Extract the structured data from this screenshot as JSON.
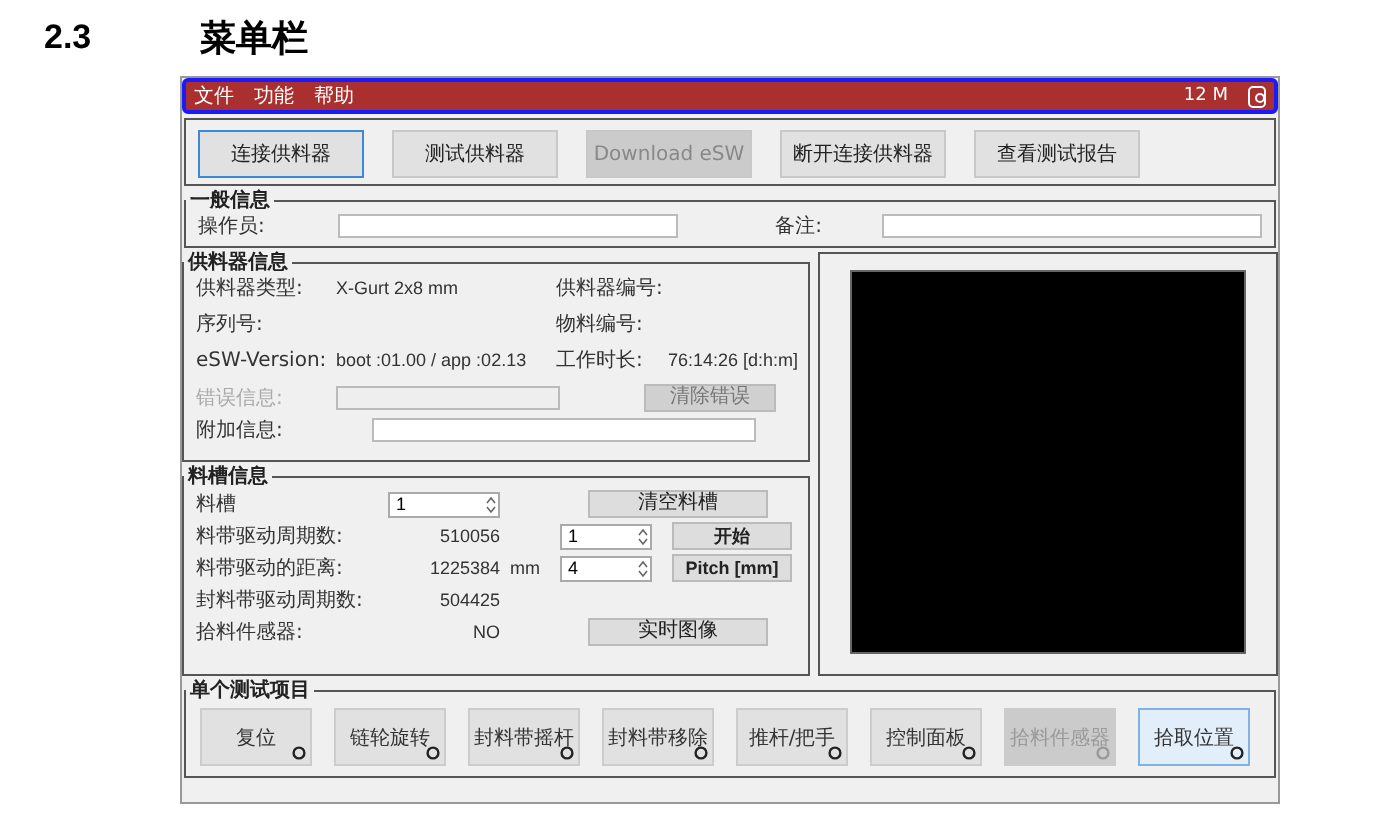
{
  "heading": {
    "number": "2.3",
    "title": "菜单栏"
  },
  "menu_bar": {
    "outlined": true,
    "items": [
      "文件",
      "功能",
      "帮助"
    ],
    "status": "12 M"
  },
  "toolbar": [
    {
      "label": "连接供料器",
      "selected": true,
      "disabled": false
    },
    {
      "label": "测试供料器",
      "selected": false,
      "disabled": false
    },
    {
      "label": "Download eSW",
      "selected": false,
      "disabled": true
    },
    {
      "label": "断开连接供料器",
      "selected": false,
      "disabled": false
    },
    {
      "label": "查看测试报告",
      "selected": false,
      "disabled": false
    }
  ],
  "general_info": {
    "title": "一般信息",
    "fields": [
      {
        "label": "操作员:"
      },
      {
        "label": "备注:"
      }
    ]
  },
  "feeder_info": {
    "title": "供料器信息",
    "details": [
      {
        "label": "供料器类型:",
        "value": "X-Gurt 2x8 mm"
      },
      {
        "label": "供料器编号:"
      },
      {
        "label": "序列号:"
      },
      {
        "label": "物料编号:"
      },
      {
        "label": "eSW-Version:",
        "value": "boot :01.00 / app :02.13"
      },
      {
        "label": "工作时长:",
        "value": "76:14:26 [d:h:m]"
      }
    ],
    "error": {
      "label": "错误信息:",
      "disabled": true,
      "button": "清除错误"
    },
    "extra": {
      "label": "附加信息:"
    }
  },
  "slot_info": {
    "title": "料槽信息",
    "rows": [
      {
        "kind": "spin_action",
        "label": "料槽",
        "spin": "1",
        "button": "清空料槽"
      },
      {
        "kind": "drive",
        "label": "料带驱动周期数:",
        "value": "510056",
        "spin": "1",
        "button": "开始"
      },
      {
        "kind": "drive",
        "label": "料带驱动的距离:",
        "value": "1225384",
        "unit": "mm",
        "spin": "4",
        "button": "Pitch [mm]"
      },
      {
        "kind": "value",
        "label": "封料带驱动周期数:",
        "value": "504425"
      },
      {
        "kind": "value_action",
        "label": "拾料件感器:",
        "value": "NO",
        "button": "实时图像"
      }
    ]
  },
  "test_items": {
    "title": "单个测试项目",
    "buttons": [
      {
        "label": "复位",
        "selected": false,
        "disabled": false
      },
      {
        "label": "链轮旋转",
        "selected": false,
        "disabled": false
      },
      {
        "label": "封料带摇杆",
        "selected": false,
        "disabled": false
      },
      {
        "label": "封料带移除",
        "selected": false,
        "disabled": false
      },
      {
        "label": "推杆/把手",
        "selected": false,
        "disabled": false
      },
      {
        "label": "控制面板",
        "selected": false,
        "disabled": false
      },
      {
        "label": "拾料件感器",
        "selected": false,
        "disabled": true
      },
      {
        "label": "拾取位置",
        "selected": true,
        "disabled": false
      }
    ]
  }
}
